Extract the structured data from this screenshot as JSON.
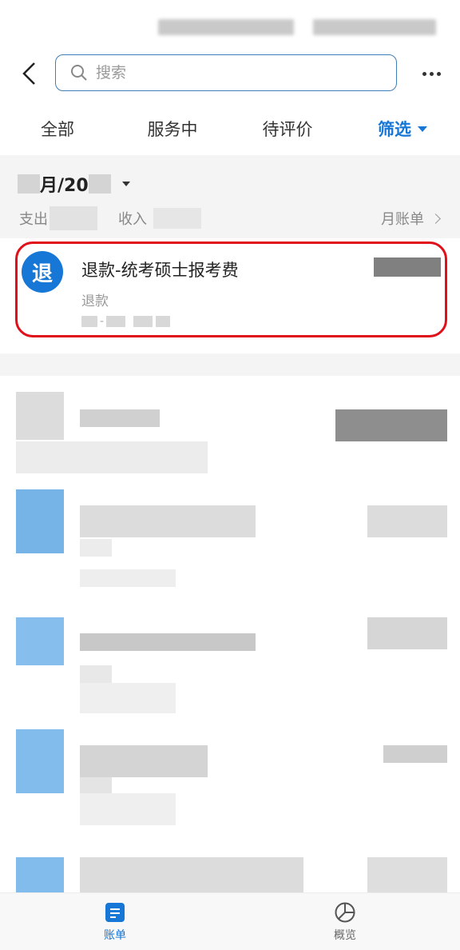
{
  "header": {
    "search_placeholder": "搜索"
  },
  "tabs": [
    {
      "label": "全部"
    },
    {
      "label": "服务中"
    },
    {
      "label": "待评价"
    },
    {
      "label": "筛选"
    }
  ],
  "month": {
    "month_suffix": "月/20",
    "expense_label": "支出",
    "income_label": "收入",
    "monthly_bill_label": "月账单"
  },
  "transaction": {
    "icon_char": "退",
    "title": "退款-统考硕士报考费",
    "subtitle": "退款"
  },
  "bottom_nav": {
    "bills_label": "账单",
    "overview_label": "概览"
  },
  "colors": {
    "accent": "#1677d6",
    "highlight": "#e0101a"
  }
}
